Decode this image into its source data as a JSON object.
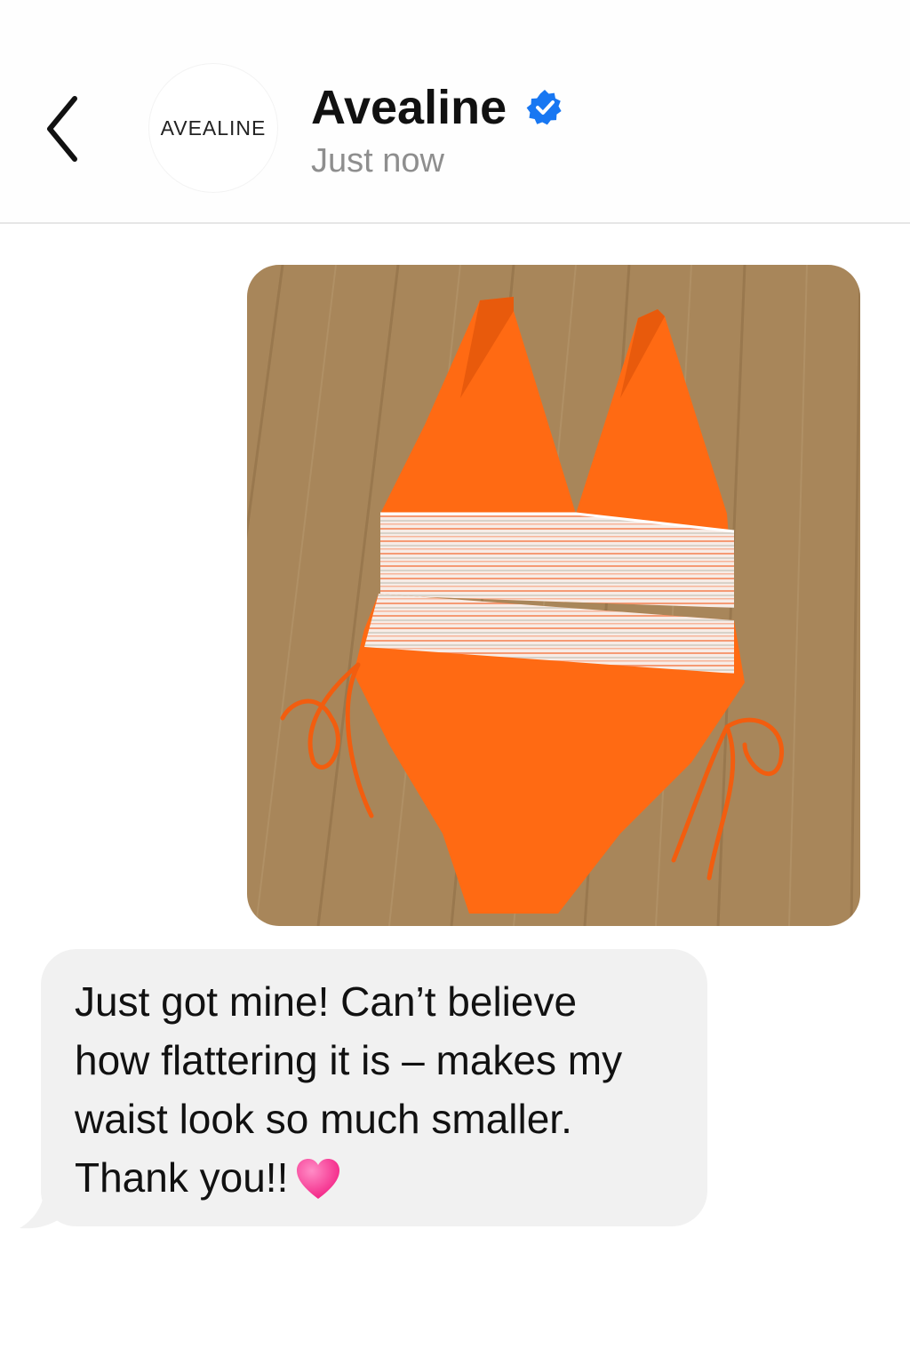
{
  "header": {
    "back_label": "back",
    "avatar_text": "AVEALINE",
    "contact_name": "Avealine",
    "status": "Just now",
    "verified_color": "#1877f2"
  },
  "messages": [
    {
      "type": "image",
      "direction": "outgoing",
      "image_description_icon": "orange-bikini-photo"
    },
    {
      "type": "text",
      "direction": "incoming",
      "text": "Just got mine! Can’t believe\nhow flattering it is – makes my\nwaist look so much smaller.\nThank you!!",
      "emoji_icon": "pink-heart-icon"
    }
  ],
  "colors": {
    "incoming_bubble": "#f1f1f1",
    "swimsuit": "#ff6a13",
    "wood": "#a8865a",
    "heart": "#ff3f9e"
  }
}
